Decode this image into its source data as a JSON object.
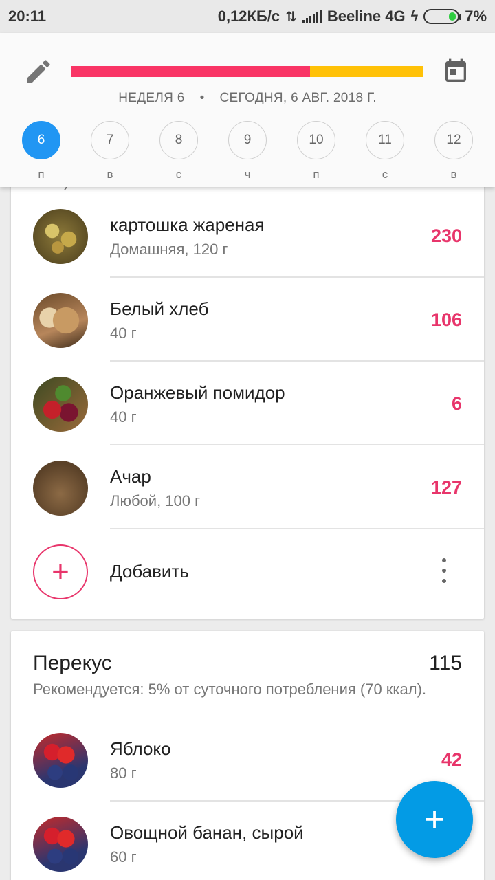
{
  "status_bar": {
    "time": "20:11",
    "speed": "0,12КБ/с",
    "carrier": "Beeline 4G",
    "battery": "7%"
  },
  "header": {
    "progress_fraction": 0.68,
    "week_label": "НЕДЕЛЯ 6",
    "separator": "•",
    "date_label": "СЕГОДНЯ, 6 АВГ. 2018 Г.",
    "days": [
      {
        "num": "6",
        "letter": "п",
        "active": true
      },
      {
        "num": "7",
        "letter": "в",
        "active": false
      },
      {
        "num": "8",
        "letter": "с",
        "active": false
      },
      {
        "num": "9",
        "letter": "ч",
        "active": false
      },
      {
        "num": "10",
        "letter": "п",
        "active": false
      },
      {
        "num": "11",
        "letter": "с",
        "active": false
      },
      {
        "num": "12",
        "letter": "в",
        "active": false
      }
    ]
  },
  "colors": {
    "accent_blue": "#039be5",
    "calorie_pink": "#e8356b",
    "progress_red": "#f93465",
    "progress_yellow": "#ffc107"
  },
  "meal1": {
    "cut_text": "ккал).",
    "items": [
      {
        "name": "картошка жареная",
        "sub": "Домашняя, 120 г",
        "kcal": "230",
        "photo": "potato-photo"
      },
      {
        "name": "Белый хлеб",
        "sub": "40 г",
        "kcal": "106",
        "photo": "bread-photo"
      },
      {
        "name": "Оранжевый помидор",
        "sub": "40 г",
        "kcal": "6",
        "photo": "vegetables-photo"
      },
      {
        "name": "Ачар",
        "sub": "Любой, 100 г",
        "kcal": "127",
        "photo": "grain-photo"
      }
    ],
    "add_label": "Добавить"
  },
  "meal2": {
    "title": "Перекус",
    "total": "115",
    "recommendation": "Рекомендуется: 5% от суточного потребления (70 ккал).",
    "items": [
      {
        "name": "Яблоко",
        "sub": "80 г",
        "kcal": "42",
        "photo": "berries-photo"
      },
      {
        "name": "Овощной банан, сырой",
        "sub": "60 г",
        "kcal": "",
        "photo": "berries-photo"
      }
    ]
  },
  "fab": {
    "icon": "plus-icon"
  }
}
